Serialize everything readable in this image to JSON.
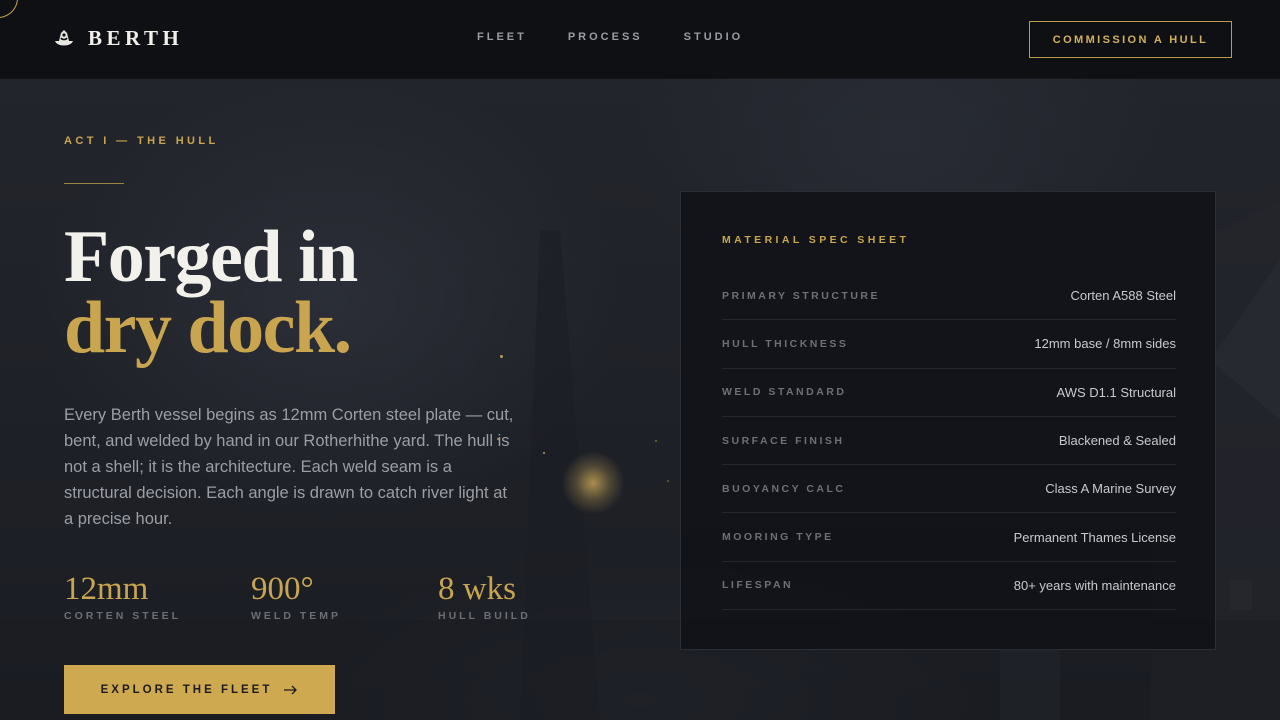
{
  "brand": {
    "name": "BERTH",
    "icon": "hull-logo-icon"
  },
  "nav": {
    "links": [
      {
        "label": "FLEET"
      },
      {
        "label": "PROCESS"
      },
      {
        "label": "STUDIO"
      }
    ],
    "cta": "COMMISSION A HULL"
  },
  "hero": {
    "eyebrow": "ACT I — THE HULL",
    "headline_line1": "Forged in",
    "headline_line2": "dry dock.",
    "lede": "Every Berth vessel begins as 12mm Corten steel plate — cut, bent, and welded by hand in our Rotherhithe yard. The hull is not a shell; it is the architecture. Each weld seam is a structural decision. Each angle is drawn to catch river light at a precise hour.",
    "stats": [
      {
        "value": "12mm",
        "label": "CORTEN STEEL"
      },
      {
        "value": "900°",
        "label": "WELD TEMP"
      },
      {
        "value": "8 wks",
        "label": "HULL BUILD"
      }
    ],
    "cta": {
      "label": "EXPLORE THE FLEET",
      "icon": "arrow-right-icon"
    }
  },
  "spec_sheet": {
    "title": "MATERIAL SPEC SHEET",
    "rows": [
      {
        "key": "PRIMARY STRUCTURE",
        "value": "Corten A588 Steel"
      },
      {
        "key": "HULL THICKNESS",
        "value": "12mm base / 8mm sides"
      },
      {
        "key": "WELD STANDARD",
        "value": "AWS D1.1 Structural"
      },
      {
        "key": "SURFACE FINISH",
        "value": "Blackened & Sealed"
      },
      {
        "key": "BUOYANCY CALC",
        "value": "Class A Marine Survey"
      },
      {
        "key": "MOORING TYPE",
        "value": "Permanent Thames License"
      },
      {
        "key": "LIFESPAN",
        "value": "80+ years with maintenance"
      }
    ]
  },
  "colors": {
    "accent": "#c9a54f",
    "header_bg": "#0f1014",
    "page_bg": "#1f2128",
    "card_bg": "#121318"
  }
}
